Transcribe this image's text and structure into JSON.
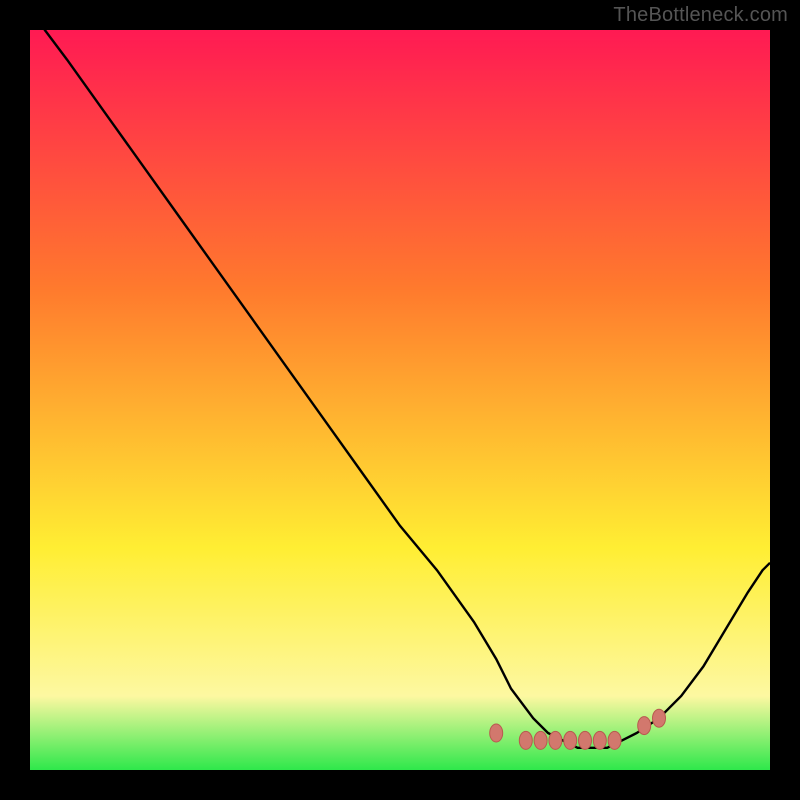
{
  "watermark": "TheBottleneck.com",
  "colors": {
    "page_bg": "#000000",
    "curve": "#000000",
    "marker_fill": "#d2786d",
    "marker_stroke": "#b85a4f",
    "gradient_top": "#ff1a53",
    "gradient_mid1": "#ff7a2d",
    "gradient_mid2": "#ffee33",
    "gradient_mid3": "#fdf8a1",
    "gradient_bottom": "#2ee84b"
  },
  "chart_data": {
    "type": "line",
    "title": "",
    "xlabel": "",
    "ylabel": "",
    "xlim": [
      0,
      100
    ],
    "ylim": [
      0,
      100
    ],
    "series": [
      {
        "name": "bottleneck-curve",
        "x": [
          0,
          2,
          5,
          10,
          15,
          20,
          25,
          30,
          35,
          40,
          45,
          50,
          55,
          60,
          63,
          65,
          68,
          70,
          72,
          74,
          76,
          78,
          80,
          82,
          85,
          88,
          91,
          94,
          97,
          99,
          100
        ],
        "values": [
          105,
          100,
          96,
          89,
          82,
          75,
          68,
          61,
          54,
          47,
          40,
          33,
          27,
          20,
          15,
          11,
          7,
          5,
          4,
          3,
          3,
          3,
          4,
          5,
          7,
          10,
          14,
          19,
          24,
          27,
          28
        ]
      }
    ],
    "markers": {
      "name": "bottom-cluster",
      "points": [
        {
          "x": 63,
          "y": 5
        },
        {
          "x": 67,
          "y": 4
        },
        {
          "x": 69,
          "y": 4
        },
        {
          "x": 71,
          "y": 4
        },
        {
          "x": 73,
          "y": 4
        },
        {
          "x": 75,
          "y": 4
        },
        {
          "x": 77,
          "y": 4
        },
        {
          "x": 79,
          "y": 4
        },
        {
          "x": 83,
          "y": 6
        },
        {
          "x": 85,
          "y": 7
        }
      ]
    }
  }
}
